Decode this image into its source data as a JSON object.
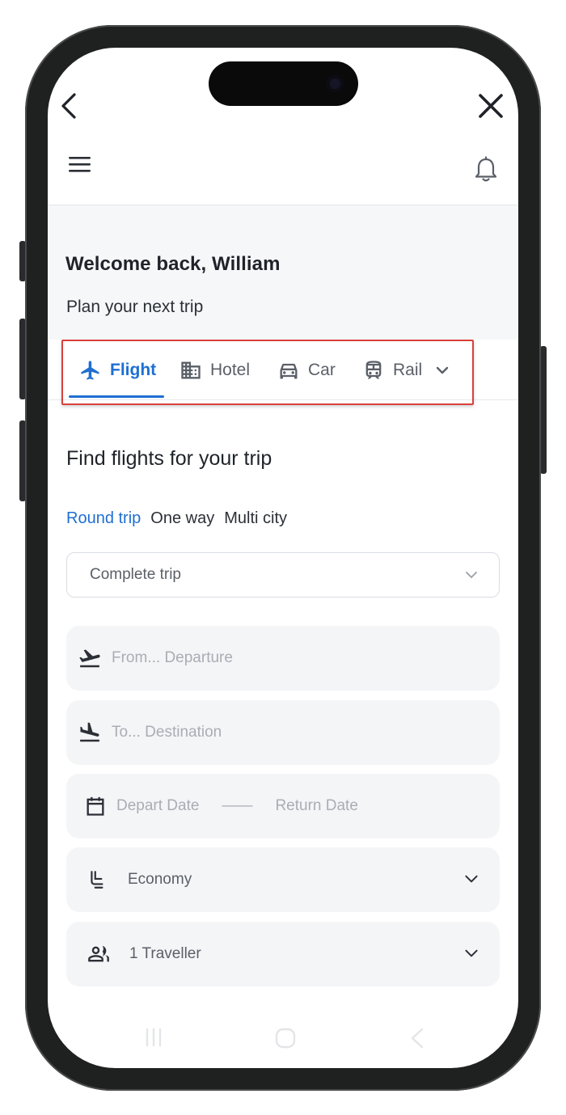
{
  "header": {
    "back_icon": "chevron-left-icon",
    "close_icon": "close-x-icon",
    "menu_icon": "hamburger-menu-icon",
    "notification_icon": "bell-icon"
  },
  "welcome": {
    "title": "Welcome back, William",
    "subtitle": "Plan your next trip"
  },
  "tabs": [
    {
      "label": "Flight",
      "icon": "airplane-icon",
      "active": true
    },
    {
      "label": "Hotel",
      "icon": "building-icon",
      "active": false
    },
    {
      "label": "Car",
      "icon": "car-icon",
      "active": false
    },
    {
      "label": "Rail",
      "icon": "train-icon",
      "active": false
    }
  ],
  "tabs_more_icon": "chevron-down-icon",
  "accent_color": "#1f6fd1",
  "highlight_color": "#d9403a",
  "search": {
    "title": "Find flights for your trip",
    "trip_types": [
      "Round trip",
      "One way",
      "Multi city"
    ],
    "active_trip_type": "Round trip",
    "trip_select_value": "Complete trip",
    "from_placeholder": "From... Departure",
    "to_placeholder": "To... Destination",
    "depart_placeholder": "Depart Date",
    "date_separator": "——",
    "return_placeholder": "Return Date",
    "cabin_class": "Economy",
    "travellers": "1 Traveller"
  },
  "system_nav": {
    "recents_icon": "recents-icon",
    "home_icon": "home-icon",
    "back_icon": "back-triangle-icon"
  }
}
